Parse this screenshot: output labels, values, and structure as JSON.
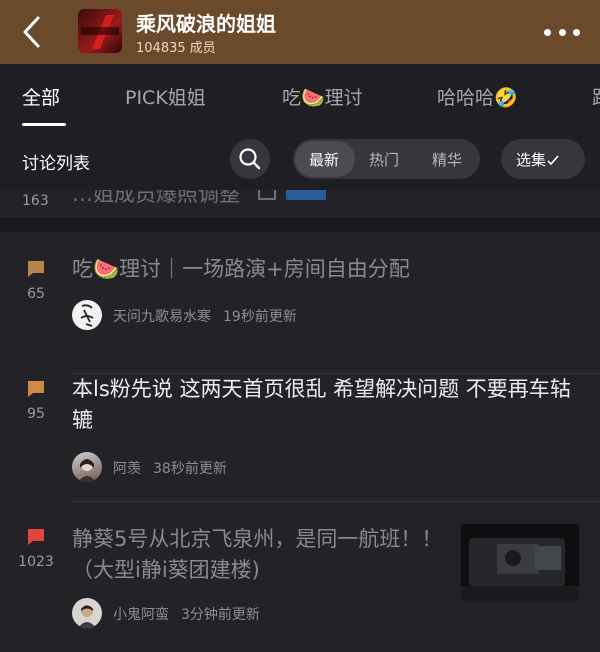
{
  "header": {
    "title": "乘风破浪的姐姐",
    "member_count": "104835",
    "member_suffix": "成员",
    "icon_text": "乘风破浪的姐姐"
  },
  "tabs": [
    {
      "label": "全部"
    },
    {
      "label": "PICK姐姐"
    },
    {
      "label": "吃🍉理讨"
    },
    {
      "label": "哈哈哈🤣"
    },
    {
      "label": "路"
    }
  ],
  "listbar": {
    "title": "讨论列表",
    "seg": [
      "最新",
      "热门",
      "精华"
    ],
    "select": "选集"
  },
  "feed": {
    "partial": {
      "count": "163",
      "text": "…姐成员爆照调整"
    },
    "posts": [
      {
        "count": "65",
        "title": "吃🍉理讨｜一场路演+房间自由分配",
        "author": "天问九歌易水寒",
        "time": "19秒前更新",
        "icon_color": "#b8834e"
      },
      {
        "count": "95",
        "title": "本ls粉先说 这两天首页很乱 希望解决问题 不要再车轱辘",
        "author": "阿羡",
        "time": "38秒前更新",
        "icon_color": "#d08a47"
      },
      {
        "count": "1023",
        "title": "静葵5号从北京飞泉州，是同一航班！！（大型i静i葵团建楼)",
        "author": "小鬼阿蛮",
        "time": "3分钟前更新",
        "icon_color": "#e0473c"
      }
    ]
  },
  "colors": {
    "header_bg": "#6b4a2b",
    "page_bg": "#1f1f23",
    "hot_icon": "#e0473c",
    "normal_icon": "#d08a47"
  }
}
